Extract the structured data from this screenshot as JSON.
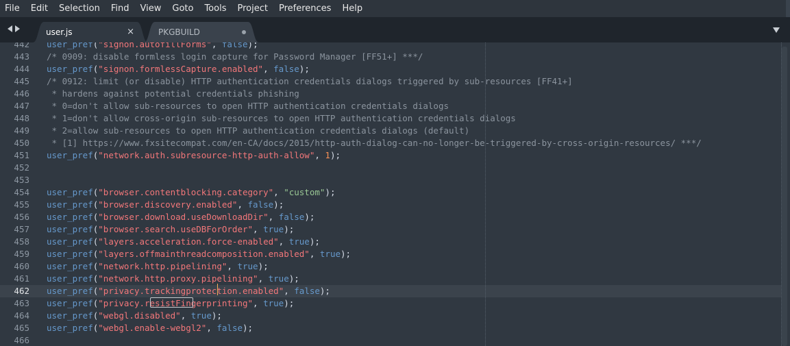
{
  "menu": [
    "File",
    "Edit",
    "Selection",
    "Find",
    "View",
    "Goto",
    "Tools",
    "Project",
    "Preferences",
    "Help"
  ],
  "tabs": [
    {
      "label": "user.js",
      "active": true,
      "close_glyph": "×"
    },
    {
      "label": "PKGBUILD",
      "active": false,
      "dirty": true
    }
  ],
  "icons": {
    "nav_left": "triangle-left",
    "nav_right": "triangle-right",
    "tab_dropdown": "triangle-down"
  },
  "colors": {
    "background": "#303841",
    "tabbar": "#1f252c",
    "active_tab": "#303841",
    "inactive_tab": "#3a424c",
    "function": "#6699cc",
    "string_key": "#f2777a",
    "string_value": "#99c794",
    "keyword": "#6699cc",
    "number": "#f99157",
    "comment": "#8b949e"
  },
  "editor": {
    "active_line": "462",
    "lines": [
      {
        "n": "442",
        "tokens": [
          [
            "fn",
            "user_pref"
          ],
          [
            "punc",
            "("
          ],
          [
            "key",
            "\"signon.autofillForms\""
          ],
          [
            "punc",
            ", "
          ],
          [
            "bool",
            "false"
          ],
          [
            "punc",
            ");"
          ]
        ]
      },
      {
        "n": "443",
        "tokens": [
          [
            "comment",
            "/* 0909: disable formless login capture for Password Manager [FF51+] ***/"
          ]
        ]
      },
      {
        "n": "444",
        "tokens": [
          [
            "fn",
            "user_pref"
          ],
          [
            "punc",
            "("
          ],
          [
            "key",
            "\"signon.formlessCapture.enabled\""
          ],
          [
            "punc",
            ", "
          ],
          [
            "bool",
            "false"
          ],
          [
            "punc",
            ");"
          ]
        ]
      },
      {
        "n": "445",
        "tokens": [
          [
            "comment",
            "/* 0912: limit (or disable) HTTP authentication credentials dialogs triggered by sub-resources [FF41+]"
          ]
        ]
      },
      {
        "n": "446",
        "tokens": [
          [
            "comment",
            " * hardens against potential credentials phishing"
          ]
        ]
      },
      {
        "n": "447",
        "tokens": [
          [
            "comment",
            " * 0=don't allow sub-resources to open HTTP authentication credentials dialogs"
          ]
        ]
      },
      {
        "n": "448",
        "tokens": [
          [
            "comment",
            " * 1=don't allow cross-origin sub-resources to open HTTP authentication credentials dialogs"
          ]
        ]
      },
      {
        "n": "449",
        "tokens": [
          [
            "comment",
            " * 2=allow sub-resources to open HTTP authentication credentials dialogs (default)"
          ]
        ]
      },
      {
        "n": "450",
        "tokens": [
          [
            "comment",
            " * [1] https://www.fxsitecompat.com/en-CA/docs/2015/http-auth-dialog-can-no-longer-be-triggered-by-cross-origin-resources/ ***/"
          ]
        ]
      },
      {
        "n": "451",
        "tokens": [
          [
            "fn",
            "user_pref"
          ],
          [
            "punc",
            "("
          ],
          [
            "key",
            "\"network.auth.subresource-http-auth-allow\""
          ],
          [
            "punc",
            ", "
          ],
          [
            "num",
            "1"
          ],
          [
            "punc",
            ");"
          ]
        ]
      },
      {
        "n": "452",
        "tokens": []
      },
      {
        "n": "453",
        "tokens": []
      },
      {
        "n": "454",
        "tokens": [
          [
            "fn",
            "user_pref"
          ],
          [
            "punc",
            "("
          ],
          [
            "key",
            "\"browser.contentblocking.category\""
          ],
          [
            "punc",
            ", "
          ],
          [
            "str",
            "\"custom\""
          ],
          [
            "punc",
            ");"
          ]
        ]
      },
      {
        "n": "455",
        "tokens": [
          [
            "fn",
            "user_pref"
          ],
          [
            "punc",
            "("
          ],
          [
            "key",
            "\"browser.discovery.enabled\""
          ],
          [
            "punc",
            ", "
          ],
          [
            "bool",
            "false"
          ],
          [
            "punc",
            ");"
          ]
        ]
      },
      {
        "n": "456",
        "tokens": [
          [
            "fn",
            "user_pref"
          ],
          [
            "punc",
            "("
          ],
          [
            "key",
            "\"browser.download.useDownloadDir\""
          ],
          [
            "punc",
            ", "
          ],
          [
            "bool",
            "false"
          ],
          [
            "punc",
            ");"
          ]
        ]
      },
      {
        "n": "457",
        "tokens": [
          [
            "fn",
            "user_pref"
          ],
          [
            "punc",
            "("
          ],
          [
            "key",
            "\"browser.search.useDBForOrder\""
          ],
          [
            "punc",
            ", "
          ],
          [
            "bool",
            "true"
          ],
          [
            "punc",
            ");"
          ]
        ]
      },
      {
        "n": "458",
        "tokens": [
          [
            "fn",
            "user_pref"
          ],
          [
            "punc",
            "("
          ],
          [
            "key",
            "\"layers.acceleration.force-enabled\""
          ],
          [
            "punc",
            ", "
          ],
          [
            "bool",
            "true"
          ],
          [
            "punc",
            ");"
          ]
        ]
      },
      {
        "n": "459",
        "tokens": [
          [
            "fn",
            "user_pref"
          ],
          [
            "punc",
            "("
          ],
          [
            "key",
            "\"layers.offmainthreadcomposition.enabled\""
          ],
          [
            "punc",
            ", "
          ],
          [
            "bool",
            "true"
          ],
          [
            "punc",
            ");"
          ]
        ]
      },
      {
        "n": "460",
        "tokens": [
          [
            "fn",
            "user_pref"
          ],
          [
            "punc",
            "("
          ],
          [
            "key",
            "\"network.http.pipelining\""
          ],
          [
            "punc",
            ", "
          ],
          [
            "bool",
            "true"
          ],
          [
            "punc",
            ");"
          ]
        ]
      },
      {
        "n": "461",
        "tokens": [
          [
            "fn",
            "user_pref"
          ],
          [
            "punc",
            "("
          ],
          [
            "key",
            "\"network.http.proxy.pipelining\""
          ],
          [
            "punc",
            ", "
          ],
          [
            "bool",
            "true"
          ],
          [
            "punc",
            ");"
          ]
        ]
      },
      {
        "n": "462",
        "tokens": [
          [
            "fn",
            "user_pref"
          ],
          [
            "punc",
            "("
          ],
          [
            "key",
            "\"privacy.trackingprotection.enabled\""
          ],
          [
            "punc",
            ", "
          ],
          [
            "bool",
            "false"
          ],
          [
            "punc",
            ");"
          ]
        ]
      },
      {
        "n": "463",
        "tokens": [
          [
            "fn",
            "user_pref"
          ],
          [
            "punc",
            "("
          ],
          [
            "key",
            "\"privacy.resistFingerprinting\""
          ],
          [
            "punc",
            ", "
          ],
          [
            "bool",
            "true"
          ],
          [
            "punc",
            ");"
          ]
        ]
      },
      {
        "n": "464",
        "tokens": [
          [
            "fn",
            "user_pref"
          ],
          [
            "punc",
            "("
          ],
          [
            "key",
            "\"webgl.disabled\""
          ],
          [
            "punc",
            ", "
          ],
          [
            "bool",
            "true"
          ],
          [
            "punc",
            ");"
          ]
        ]
      },
      {
        "n": "465",
        "tokens": [
          [
            "fn",
            "user_pref"
          ],
          [
            "punc",
            "("
          ],
          [
            "key",
            "\"webgl.enable-webgl2\""
          ],
          [
            "punc",
            ", "
          ],
          [
            "bool",
            "false"
          ],
          [
            "punc",
            ");"
          ]
        ]
      },
      {
        "n": "466",
        "tokens": []
      }
    ]
  }
}
